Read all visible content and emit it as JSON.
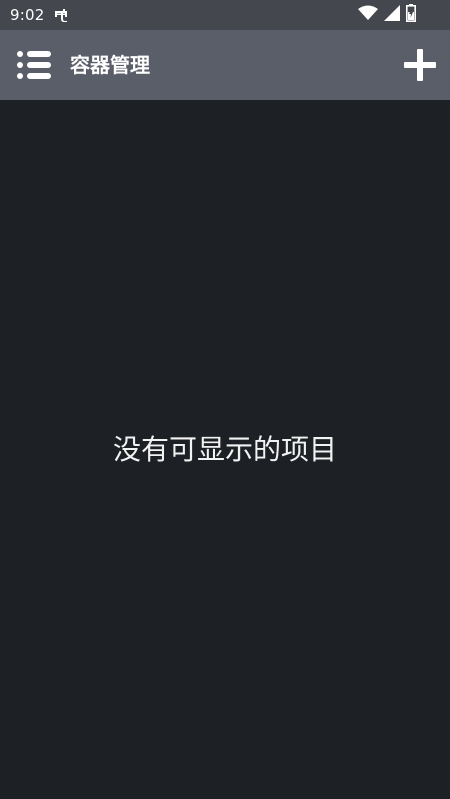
{
  "status_bar": {
    "time": "9:02",
    "icons": [
      "notification-icon",
      "wifi-icon",
      "signal-icon",
      "battery-charging-icon"
    ]
  },
  "toolbar": {
    "title": "容器管理",
    "menu_icon": "menu-list-icon",
    "add_icon": "plus-icon"
  },
  "content": {
    "empty_message": "没有可显示的项目"
  },
  "colors": {
    "status_bar_bg": "#44474d",
    "toolbar_bg": "#5a5e68",
    "content_bg": "#1d2024",
    "text": "#ffffff"
  }
}
